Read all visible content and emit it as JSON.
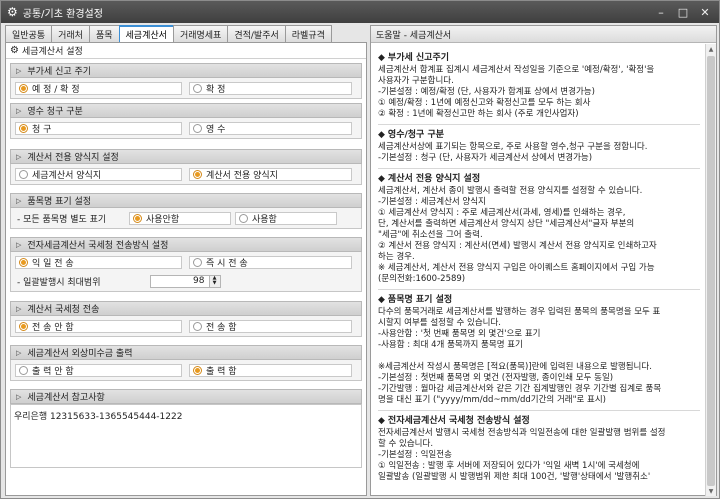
{
  "window": {
    "title": "공통/기초 환경설정"
  },
  "tabs": [
    "일반공통",
    "거래처",
    "품목",
    "세금계산서",
    "거래명세표",
    "견적/발주서",
    "라벨규격"
  ],
  "active_tab": 3,
  "panel_title": "세금계산서 설정",
  "sections": {
    "vat_cycle": {
      "title": "부가세 신고 주기",
      "opt1": "예 정 / 확 정",
      "opt2": "확 정",
      "selected": 1
    },
    "receipt": {
      "title": "영수 청구 구분",
      "opt1": "청 구",
      "opt2": "영 수",
      "selected": 1
    },
    "form": {
      "title": "계산서 전용 양식지 설정",
      "opt1": "세금계산서 양식지",
      "opt2": "계산서 전용 양식지",
      "selected": 2
    },
    "item_name": {
      "title": "품목명 표기 설정",
      "label": "- 모든 품목명 별도 표기",
      "opt1": "사용안함",
      "opt2": "사용함",
      "selected": 1
    },
    "e_tax": {
      "title": "전자세금계산서 국세청 전송방식 설정",
      "opt1": "익 일 전 송",
      "opt2": "즉 시 전 송",
      "selected": 1,
      "limit_label": "- 일괄발행시 최대범위",
      "limit_value": "98"
    },
    "nts": {
      "title": "계산서 국세청 전송",
      "opt1": "전 송 안 함",
      "opt2": "전 송 함",
      "selected": 1
    },
    "receivable": {
      "title": "세금계산서 외상미수금 출력",
      "opt1": "출 력 안 함",
      "opt2": "출 력 함",
      "selected": 2
    },
    "memo": {
      "title": "세금계산서 참고사항",
      "value": "우리은행 12315633-1365545444-1222"
    }
  },
  "help": {
    "title": "도움말 - 세금계산서",
    "s1_title": "부가세 신고주기",
    "s1_body": "세금계산서 합계표 집계시 세금계산서 작성일을 기준으로 '예정/확정', '확정'을\n사용자가 구분합니다.\n-기본설정 : 예정/확정 (단, 사용자가 합계표 상에서 변경가능)\n① 예정/확정 : 1년에 예정신고와 확정신고를 모두 하는 회사\n② 확정 : 1년에 확정신고만 하는 회사 (주로 개인사업자)",
    "s2_title": "영수/청구 구분",
    "s2_body": "세금계산서상에 표기되는 항목으로, 주로 사용할 영수,청구 구분을 정합니다.\n-기본설정 : 청구 (단, 사용자가 세금계산서 상에서 변경가능)",
    "s3_title": "계산서 전용 양식지 설정",
    "s3_body": "세금계산서, 계산서 종이 발행시 출력할 전용 양식지를 설정할 수 있습니다.\n-기본설정 : 세금계산서 양식지\n① 세금계산서 양식지 : 주로 세금계산서(과세, 영세)를 인쇄하는 경우,\n    단, 계산서를 출력하면 세금계산서 양식지 상단 \"세금계산서\"글자 부분의\n    \"세금\"에 취소선을 그어 출력.\n② 계산서 전용 양식지 : 계산서(면세) 발행시 계산서 전용 양식지로 인쇄하고자\n    하는 경우.\n※ 세금계산서, 계산서 전용 양식지 구입은 아이퀘스트 홈페이지에서 구입 가능\n    (문의전화:1600-2589)",
    "s4_title": "품목명 표기 설정",
    "s4_body": "다수의 품목거래로 세금계산서를 발행하는 경우 입력된 품목의 품목명을 모두 표\n시할지 여부를 설정할 수 있습니다.\n-사용안함 : '첫 번째 품목명 외 몇건'으로 표기\n-사용함    : 최대 4개 품목까지 품목명 표기\n\n※세금계산서 작성시 품목명은 [적요(품목)]란에 입력된 내용으로 발행됩니다.\n-기본설정 : 첫번째 품목명 외 몇건 (전자발행, 종이인쇄 모두 동일)\n-기간발행 : 월마감 세금계산서와 같은 기간 집계발행인 경우 기간별 집계로 품목\n    명을 대신 표기 (\"yyyy/mm/dd~mm/dd기간의 거래\"로 표시)",
    "s5_title": "전자세금계산서 국세청 전송방식 설정",
    "s5_body": "전자세금계산서 발행시 국세청 전송방식과 익일전송에 대한 일괄발행 범위를 설정\n할 수 있습니다.\n-기본설정 : 익일전송\n① 익일전송 : 발행 후 서버에 저장되어 있다가 '익일 새벽 1시'에 국세청에\n    일괄발송 (일괄발행 시 발행범위 제한 최대 100건, '발행'상태에서 '발행취소'"
  }
}
